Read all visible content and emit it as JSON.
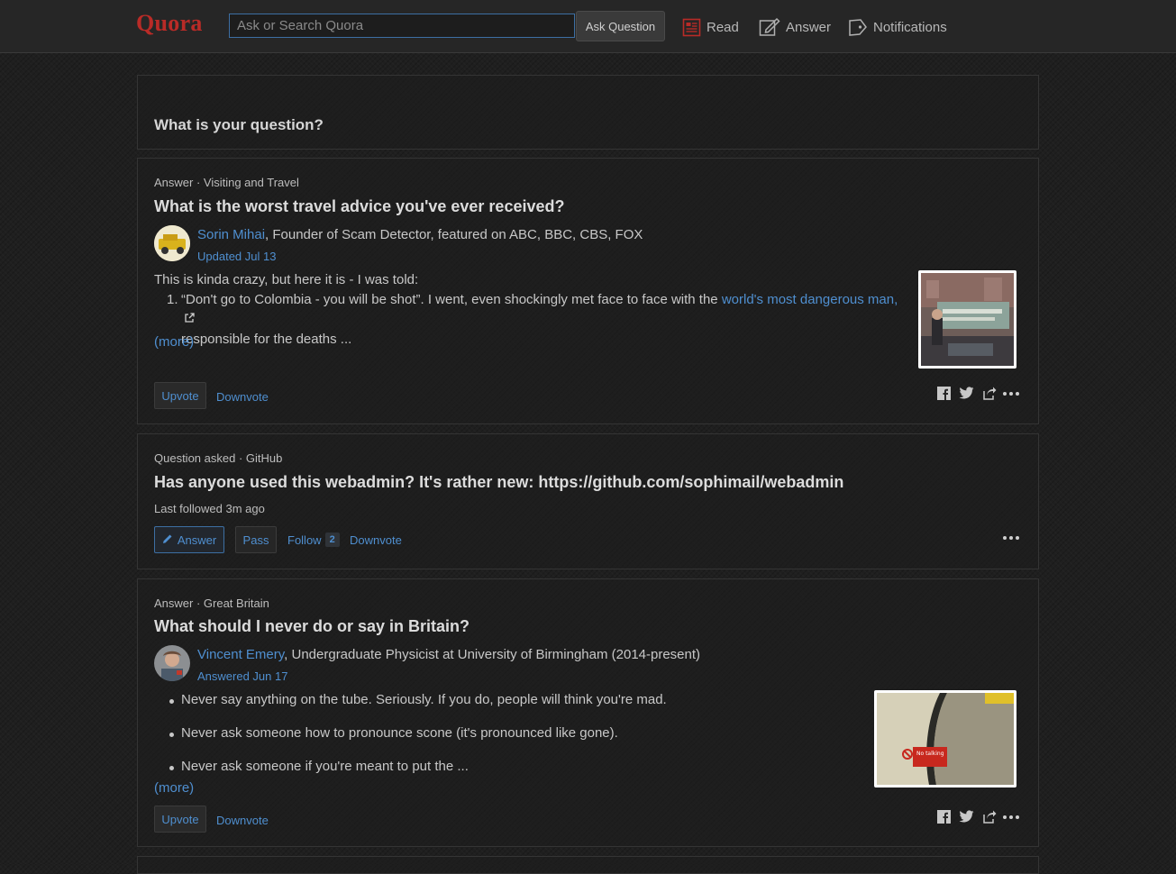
{
  "header": {
    "logo": "Quora",
    "search_placeholder": "Ask or Search Quora",
    "ask_button": "Ask Question",
    "nav": {
      "read": "Read",
      "answer": "Answer",
      "notifications": "Notifications"
    }
  },
  "ask_box": {
    "prompt": "What is your question?"
  },
  "feed": [
    {
      "meta": "Answer · Visiting and Travel",
      "title": "What is the worst travel advice you've ever received?",
      "author_name": "Sorin Mihai",
      "author_cred": ", Founder of Scam Detector, featured on ABC, BBC, CBS, FOX",
      "date": "Updated Jul 13",
      "intro": "This is kinda crazy, but here it is - I was told:",
      "item_number": "1.",
      "item_text": "“Don't go to Colombia - you will be shot”. I went, even shockingly met face to face with the ",
      "item_link": "world's most dangerous man,",
      "item_text2": "responsible for the deaths ...",
      "more": "(more)",
      "upvote": "Upvote",
      "downvote": "Downvote",
      "thumbnail_icon": "street-mural-photo"
    },
    {
      "meta": "Question asked · GitHub",
      "title": "Has anyone used this webadmin? It's rather new: https://github.com/sophimail/webadmin",
      "followed": "Last followed 3m ago",
      "answer": "Answer",
      "pass": "Pass",
      "follow": "Follow",
      "follow_count": "2",
      "downvote": "Downvote"
    },
    {
      "meta": "Answer · Great Britain",
      "title": "What should I never do or say in Britain?",
      "author_name": "Vincent Emery",
      "author_cred": ", Undergraduate Physicist at University of Birmingham (2014-present)",
      "date": "Answered Jun 17",
      "bullets": [
        "Never say anything on the tube. Seriously. If you do, people will think you're mad.",
        "Never ask someone how to pronounce scone (it's pronounced like gone).",
        "Never ask someone if you're meant to put the ..."
      ],
      "more": "(more)",
      "upvote": "Upvote",
      "downvote": "Downvote",
      "thumbnail_sign": "No talking"
    }
  ],
  "colors": {
    "brand": "#b92b27",
    "link": "#4f8fd0",
    "background": "#1f1f1f"
  }
}
